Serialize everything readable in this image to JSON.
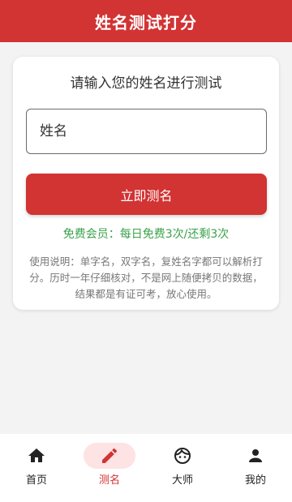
{
  "app": {
    "title": "姓名测试打分"
  },
  "form": {
    "prompt": "请输入您的姓名进行测试",
    "name_placeholder": "姓名",
    "name_value": "",
    "submit_label": "立即测名",
    "membership_text": "免费会员：每日免费3次/还剩3次",
    "instructions": "使用说明：单字名，双字名，复姓名字都可以解析打分。历时一年仔细核对，不是网上随便拷贝的数据，结果都是有证可考，放心使用。"
  },
  "nav": {
    "items": [
      {
        "label": "首页",
        "icon": "home-icon",
        "active": false
      },
      {
        "label": "测名",
        "icon": "pencil-icon",
        "active": true
      },
      {
        "label": "大师",
        "icon": "face-icon",
        "active": false
      },
      {
        "label": "我的",
        "icon": "person-icon",
        "active": false
      }
    ]
  },
  "colors": {
    "primary": "#d23333",
    "accent_green": "#3aa24a",
    "active_pill": "#fde3e3",
    "background": "#f3f3f3"
  }
}
